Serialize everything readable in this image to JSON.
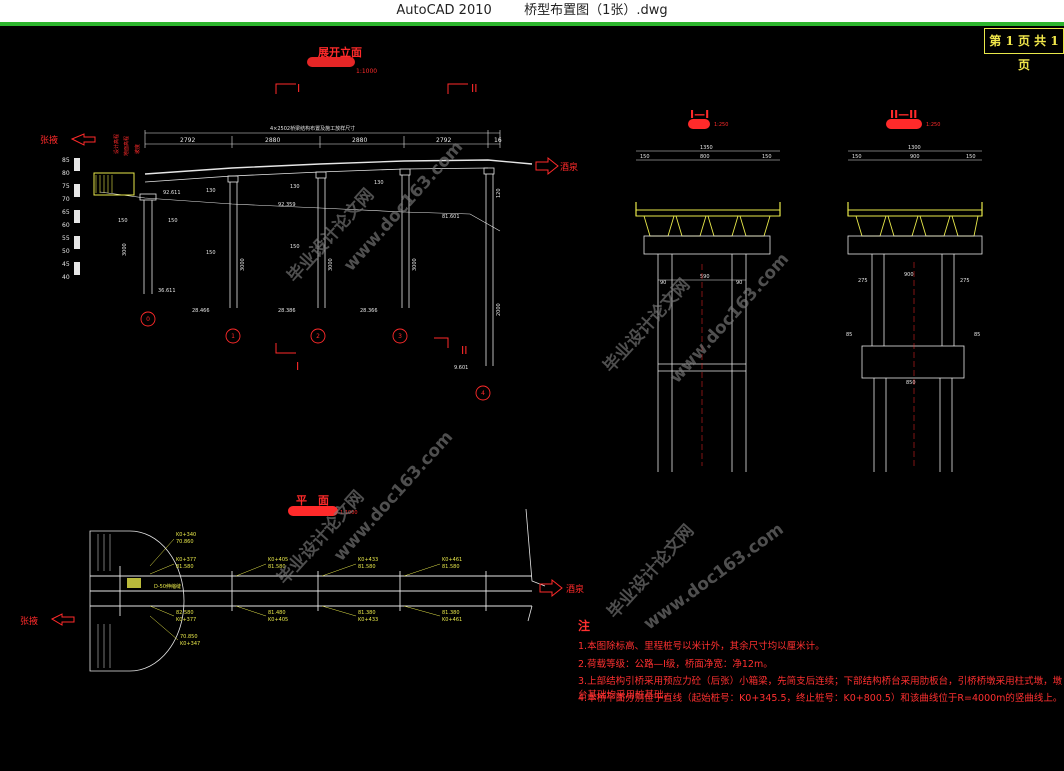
{
  "window": {
    "app": "AutoCAD 2010",
    "file": "桥型布置图（1张）.dwg"
  },
  "page_box": "第 1 页  共 1 页",
  "elevation": {
    "title": "展开立面",
    "scale": "1:1000",
    "left_direction": "张掖",
    "right_direction": "酒泉",
    "overall_dim": "4×2502桥梁结构布置及施工放样尺寸",
    "spans": [
      "2792",
      "2880",
      "2880",
      "2792"
    ],
    "end_dim": "16",
    "section_I": "I",
    "section_II": "II",
    "elev_scale_labels": [
      "85",
      "80",
      "75",
      "70",
      "65",
      "60",
      "55",
      "50",
      "45",
      "40"
    ],
    "pier_numbers": [
      "0",
      "1",
      "2",
      "3",
      "4"
    ],
    "pier_heights": [
      "3000",
      "3000",
      "3000",
      "3000",
      "2000"
    ],
    "base_elevations": [
      "36.611",
      "28.466",
      "28.386",
      "28.366",
      "9.601"
    ],
    "top_elevations": [
      "92.611",
      "92.359",
      "81.601"
    ],
    "small_dims": [
      "150",
      "150",
      "150",
      "150",
      "130",
      "130",
      "130",
      "120"
    ]
  },
  "section_I": {
    "title": "I—I",
    "scale": "1:250",
    "width": "1350",
    "parts": [
      "150",
      "800",
      "150"
    ],
    "col_gap": "590",
    "dims": [
      "90",
      "90"
    ]
  },
  "section_II": {
    "title": "II—II",
    "scale": "1:250",
    "width": "1300",
    "parts": [
      "150",
      "900",
      "150"
    ],
    "cap": "900",
    "sides": [
      "275",
      "275"
    ],
    "base": "850",
    "side_ext": [
      "85",
      "85"
    ]
  },
  "plan": {
    "title": "平　面",
    "scale": "1:1000",
    "left_direction": "张掖",
    "right_direction": "酒泉",
    "stations_top": [
      "K0+340",
      "K0+377",
      "K0+405",
      "K0+433",
      "K0+461"
    ],
    "stations_bottom": [
      "K0+377",
      "K0+405",
      "K0+433",
      "K0+461"
    ],
    "elev_top": [
      "70.860",
      "81.580",
      "81.580",
      "81.580",
      "81.580"
    ],
    "elev_bottom": [
      "82.580",
      "81.480",
      "81.380",
      "81.380"
    ],
    "corner_bottom": [
      "70.850",
      "K0+347"
    ],
    "center_label": "D-50伸缩缝"
  },
  "notes": {
    "title": "注",
    "items": [
      "1.本图除标高、里程桩号以米计外，其余尺寸均以厘米计。",
      "2.荷载等级：公路—I级，桥面净宽：净12m。",
      "3.上部结构引桥采用预应力砼（后张）小箱梁，先简支后连续；下部结构桥台采用肋板台，引桥桥墩采用柱式墩，墩台基础均采用桩基础。",
      "4.本桥平面分别位于直线（起始桩号：K0+345.5，终止桩号：K0+800.5）和该曲线位于R=4000m的竖曲线上。"
    ]
  },
  "watermark": {
    "cn": "毕业设计论文网",
    "url": "www.doc163.com"
  },
  "colors": {
    "cad_bg": "#000000",
    "red": "#ff2a2a",
    "yellow": "#e8e84a",
    "green": "#2db52d",
    "white": "#e6e6e6",
    "cyan": "#5fd7d7"
  }
}
